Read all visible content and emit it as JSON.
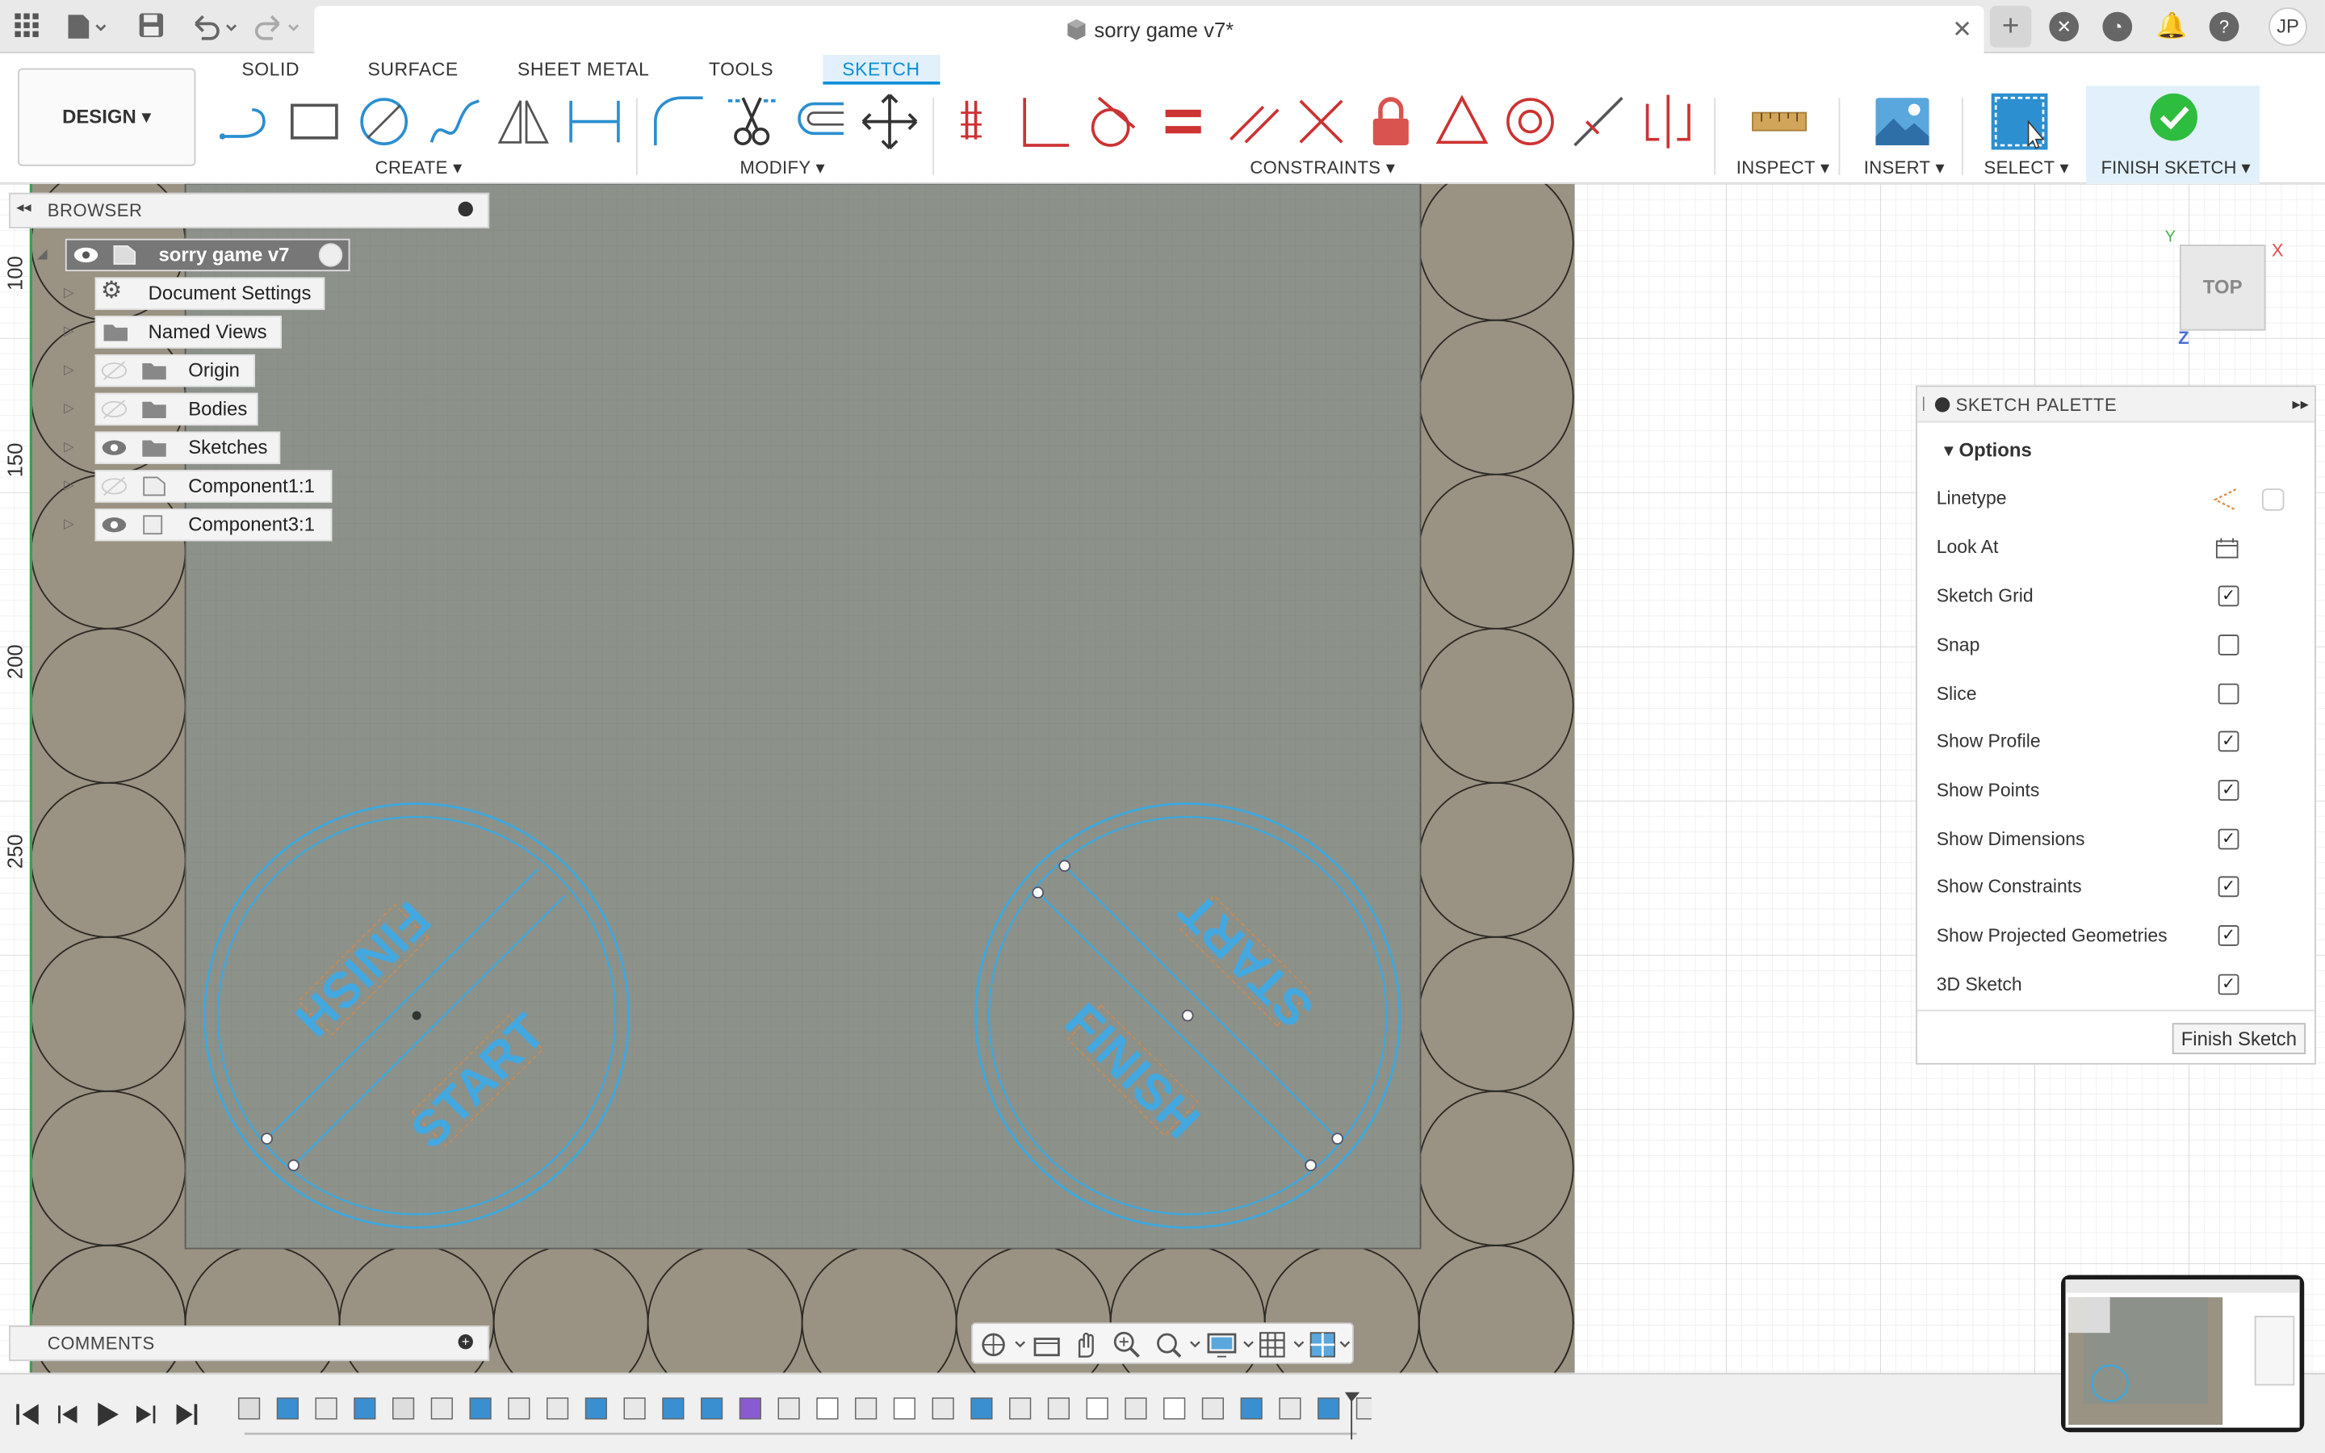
{
  "title_bar": {
    "document_title": "sorry game v7*",
    "user_initials": "JP"
  },
  "ribbon": {
    "workspace": "DESIGN",
    "tabs": [
      "SOLID",
      "SURFACE",
      "SHEET METAL",
      "TOOLS",
      "SKETCH"
    ],
    "active_tab": "SKETCH",
    "groups": {
      "create": "CREATE",
      "modify": "MODIFY",
      "constraints": "CONSTRAINTS",
      "inspect": "INSPECT",
      "insert": "INSERT",
      "select": "SELECT",
      "finish": "FINISH SKETCH"
    }
  },
  "browser": {
    "title": "BROWSER",
    "items": [
      {
        "label": "sorry game v7"
      },
      {
        "label": "Document Settings"
      },
      {
        "label": "Named Views"
      },
      {
        "label": "Origin"
      },
      {
        "label": "Bodies"
      },
      {
        "label": "Sketches"
      },
      {
        "label": "Component1:1"
      },
      {
        "label": "Component3:1"
      }
    ]
  },
  "ruler": {
    "ticks": [
      "100",
      "150",
      "200",
      "250"
    ]
  },
  "viewcube": {
    "face": "TOP",
    "axis_x": "X",
    "axis_y": "Y",
    "axis_z": "Z"
  },
  "sketch_text": {
    "finish": "FINISH",
    "start": "START"
  },
  "sketch_palette": {
    "title": "SKETCH PALETTE",
    "section": "Options",
    "options": [
      {
        "label": "Linetype"
      },
      {
        "label": "Look At"
      },
      {
        "label": "Sketch Grid",
        "checked": true
      },
      {
        "label": "Snap",
        "checked": false
      },
      {
        "label": "Slice",
        "checked": false
      },
      {
        "label": "Show Profile",
        "checked": true
      },
      {
        "label": "Show Points",
        "checked": true
      },
      {
        "label": "Show Dimensions",
        "checked": true
      },
      {
        "label": "Show Constraints",
        "checked": true
      },
      {
        "label": "Show Projected Geometries",
        "checked": true
      },
      {
        "label": "3D Sketch",
        "checked": true
      }
    ],
    "finish_button": "Finish Sketch"
  },
  "comments": {
    "title": "COMMENTS"
  },
  "colors": {
    "accent": "#0a8fd8",
    "sketch_line": "#3aa9e0",
    "board_fill": "#9a9282",
    "grid_area": "#8c918a",
    "finish_check": "#2ebd3f"
  }
}
